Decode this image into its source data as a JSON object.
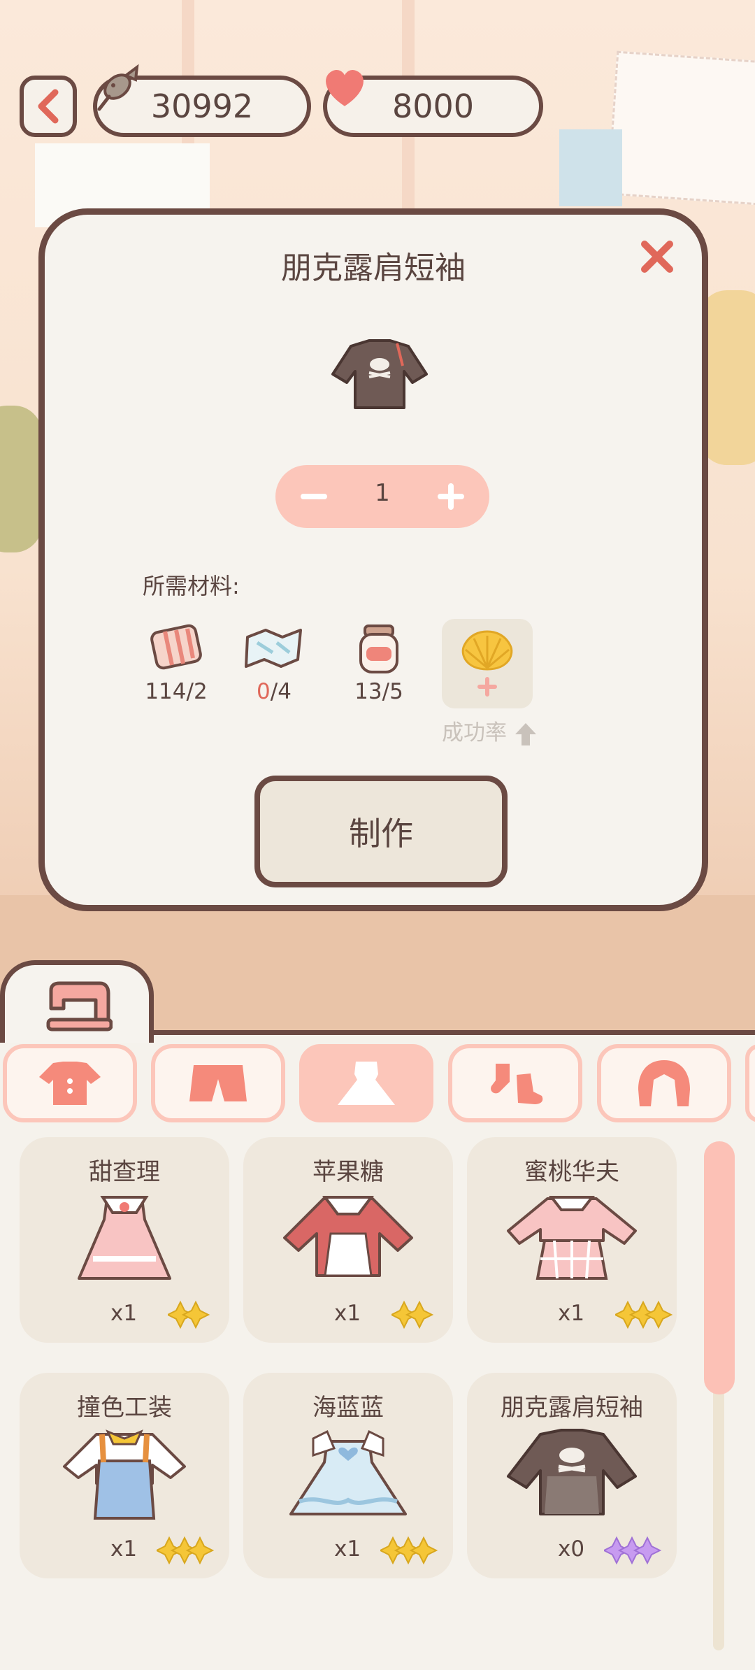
{
  "topbar": {
    "fish_coins": "30992",
    "hearts": "8000"
  },
  "dialog": {
    "title": "朋克露肩短袖",
    "quantity": "1",
    "materials_label": "所需材料:",
    "materials": [
      {
        "icon": "fabric-roll-icon",
        "have": "114",
        "need": "2",
        "enough": true
      },
      {
        "icon": "map-pattern-icon",
        "have": "0",
        "need": "4",
        "enough": false
      },
      {
        "icon": "jar-icon",
        "have": "13",
        "need": "5",
        "enough": true
      }
    ],
    "success_rate_label": "成功率",
    "make_button": "制作"
  },
  "categories": [
    {
      "icon": "top-icon",
      "active": false
    },
    {
      "icon": "pants-icon",
      "active": false
    },
    {
      "icon": "dress-icon",
      "active": true
    },
    {
      "icon": "socks-icon",
      "active": false
    },
    {
      "icon": "hair-icon",
      "active": false
    }
  ],
  "items": [
    {
      "name": "甜查理",
      "qty": "x1",
      "stars": 2,
      "star_color": "#f5c637"
    },
    {
      "name": "苹果糖",
      "qty": "x1",
      "stars": 2,
      "star_color": "#f5c637"
    },
    {
      "name": "蜜桃华夫",
      "qty": "x1",
      "stars": 3,
      "star_color": "#f5c637"
    },
    {
      "name": "撞色工装",
      "qty": "x1",
      "stars": 3,
      "star_color": "#f5c637"
    },
    {
      "name": "海蓝蓝",
      "qty": "x1",
      "stars": 3,
      "star_color": "#f5c637"
    },
    {
      "name": "朋克露肩短袖",
      "qty": "x0",
      "stars": 3,
      "star_color": "#c79bf0"
    }
  ],
  "colors": {
    "outline": "#6b4a43",
    "accent_pink": "#fcc6ba",
    "close_red": "#e0685a",
    "star_gold": "#f5c637",
    "star_purple": "#c79bf0"
  }
}
